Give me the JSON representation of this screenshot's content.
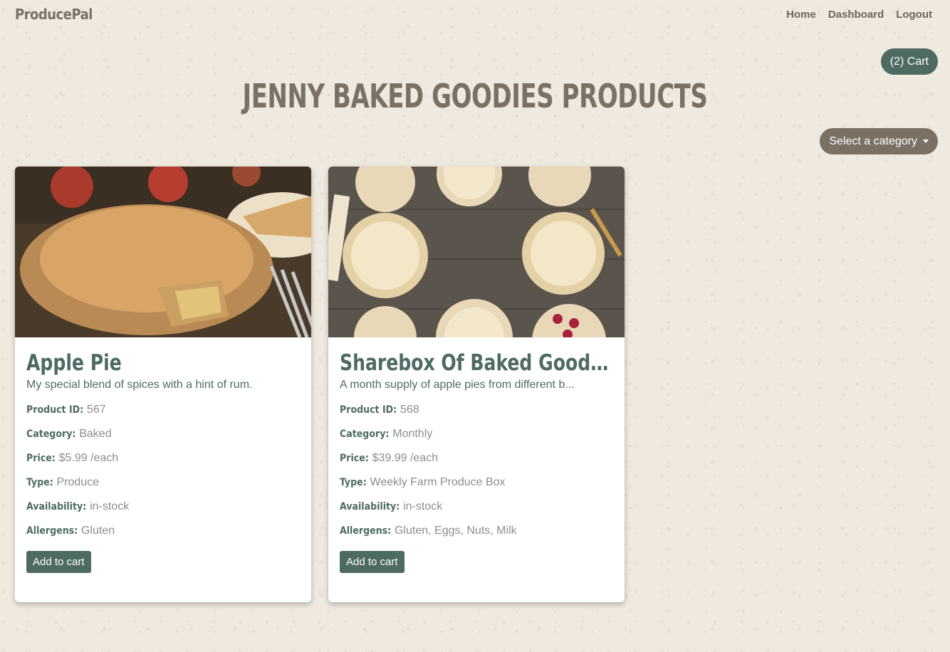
{
  "brand": "ProducePal",
  "nav": {
    "home": "Home",
    "dashboard": "Dashboard",
    "logout": "Logout"
  },
  "cart_label": "(2) Cart",
  "page_title": "JENNY BAKED GOODIES PRODUCTS",
  "category_select": "Select a category",
  "labels": {
    "product_id": "Product ID:",
    "category": "Category:",
    "price": "Price:",
    "type": "Type:",
    "availability": "Availability:",
    "allergens": "Allergens:",
    "add_to_cart": "Add to cart"
  },
  "products": [
    {
      "title": "Apple Pie",
      "description": "My special blend of spices with a hint of rum.",
      "product_id": "567",
      "category": "Baked",
      "price": "$5.99 /each",
      "type": "Produce",
      "availability": "in-stock",
      "allergens": "Gluten",
      "image": "apple-pie-photo"
    },
    {
      "title": "Sharebox Of Baked Goods F...",
      "description": "A month supply of apple pies from different b...",
      "product_id": "568",
      "category": "Monthly",
      "price": "$39.99 /each",
      "type": "Weekly Farm Produce Box",
      "availability": "in-stock",
      "allergens": "Gluten, Eggs, Nuts, Milk",
      "image": "pie-crusts-photo"
    }
  ],
  "colors": {
    "accent": "#4d6b63",
    "brown": "#7a7064",
    "background": "#efe9df"
  }
}
